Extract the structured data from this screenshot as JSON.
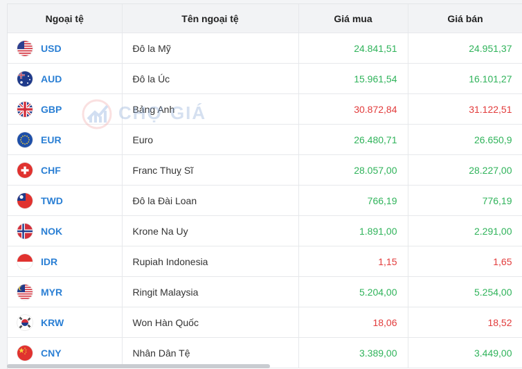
{
  "table": {
    "headers": {
      "code": "Ngoại tệ",
      "name": "Tên ngoại tệ",
      "buy": "Giá mua",
      "sell": "Giá bán"
    },
    "rows": [
      {
        "code": "USD",
        "name": "Đô la Mỹ",
        "buy": "24.841,51",
        "sell": "24.951,37",
        "trend": "up",
        "flag": "us-flag-icon"
      },
      {
        "code": "AUD",
        "name": "Đô la Úc",
        "buy": "15.961,54",
        "sell": "16.101,27",
        "trend": "up",
        "flag": "au-flag-icon"
      },
      {
        "code": "GBP",
        "name": "Bảng Anh",
        "buy": "30.872,84",
        "sell": "31.122,51",
        "trend": "down",
        "flag": "gb-flag-icon"
      },
      {
        "code": "EUR",
        "name": "Euro",
        "buy": "26.480,71",
        "sell": "26.650,9",
        "trend": "up",
        "flag": "eu-flag-icon"
      },
      {
        "code": "CHF",
        "name": "Franc Thuỵ Sĩ",
        "buy": "28.057,00",
        "sell": "28.227,00",
        "trend": "up",
        "flag": "ch-flag-icon"
      },
      {
        "code": "TWD",
        "name": "Đô la Đài Loan",
        "buy": "766,19",
        "sell": "776,19",
        "trend": "up",
        "flag": "tw-flag-icon"
      },
      {
        "code": "NOK",
        "name": "Krone Na Uy",
        "buy": "1.891,00",
        "sell": "2.291,00",
        "trend": "up",
        "flag": "no-flag-icon"
      },
      {
        "code": "IDR",
        "name": "Rupiah Indonesia",
        "buy": "1,15",
        "sell": "1,65",
        "trend": "down",
        "flag": "id-flag-icon"
      },
      {
        "code": "MYR",
        "name": "Ringit Malaysia",
        "buy": "5.204,00",
        "sell": "5.254,00",
        "trend": "up",
        "flag": "my-flag-icon"
      },
      {
        "code": "KRW",
        "name": "Won Hàn Quốc",
        "buy": "18,06",
        "sell": "18,52",
        "trend": "down",
        "flag": "kr-flag-icon"
      },
      {
        "code": "CNY",
        "name": "Nhân Dân Tệ",
        "buy": "3.389,00",
        "sell": "3.449,00",
        "trend": "up",
        "flag": "cn-flag-icon"
      }
    ]
  },
  "watermark": {
    "text": "CHỢ GIÁ"
  },
  "colors": {
    "up": "#2fb35a",
    "down": "#e23b3b",
    "code": "#2a7fd4"
  }
}
